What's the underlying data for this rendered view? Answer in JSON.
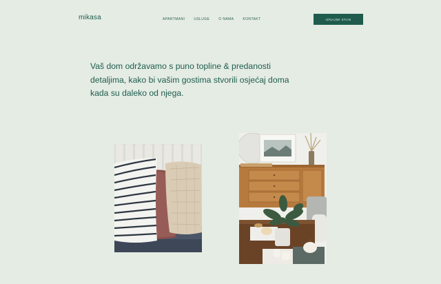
{
  "brand": {
    "logo_text": "mikasa"
  },
  "nav": {
    "items": [
      {
        "label": "APARTMANI"
      },
      {
        "label": "USLUGE"
      },
      {
        "label": "O NAMA"
      },
      {
        "label": "KONTAKT"
      }
    ],
    "cta_label": "IZNAJMI STAN"
  },
  "hero": {
    "headline": "Vaš dom održavamo s puno topline & predanosti detaljima, kako bi vašim gostima stvorili osjećaj doma kada su daleko od njega."
  },
  "colors": {
    "background": "#e4ece4",
    "accent": "#1f5c4e"
  },
  "images": [
    {
      "name": "cushions-photo",
      "subject": "striped and linen cushions"
    },
    {
      "name": "living-room-photo",
      "subject": "wooden dresser, plant and pumpkins"
    }
  ]
}
